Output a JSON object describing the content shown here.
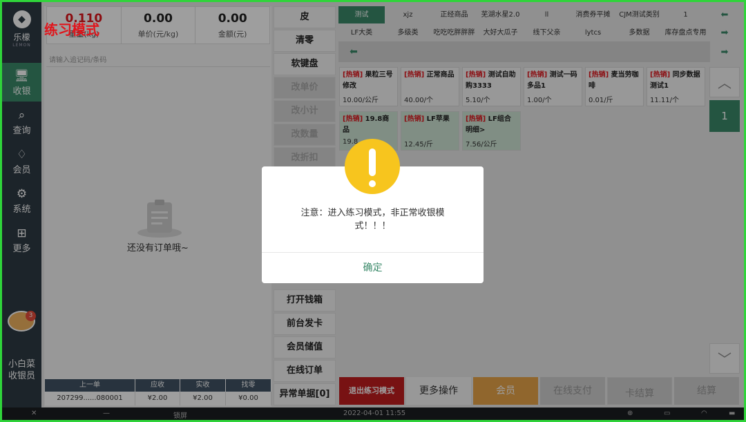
{
  "app": {
    "mode_title": "练习模式",
    "logo_text": "乐檬",
    "logo_sub": "LEMON"
  },
  "nav": [
    {
      "label": "收银",
      "icon": "cashier-icon",
      "glyph": "🖥"
    },
    {
      "label": "查询",
      "icon": "query-icon",
      "glyph": "⌕"
    },
    {
      "label": "会员",
      "icon": "member-icon",
      "glyph": "♢"
    },
    {
      "label": "系统",
      "icon": "system-icon",
      "glyph": "⚙"
    },
    {
      "label": "更多",
      "icon": "more-icon",
      "glyph": "⊞"
    }
  ],
  "avatar_badge": "3",
  "cashier": {
    "line1": "小白菜",
    "line2": "收银员"
  },
  "metrics": {
    "weight_value": "0.110",
    "weight_label": "重量(kg)",
    "unit_price_value": "0.00",
    "unit_price_label": "单价(元/kg)",
    "amount_value": "0.00",
    "amount_label": "金额(元)"
  },
  "scan_placeholder": "请输入追记码/条码",
  "empty_text": "还没有订单哦~",
  "last_order": {
    "headers": [
      "上一单",
      "应收",
      "实收",
      "找零"
    ],
    "values": [
      "207299......080001",
      "¥2.00",
      "¥2.00",
      "¥0.00"
    ]
  },
  "functions": {
    "top": [
      "皮",
      "清零",
      "软键盘"
    ],
    "disabled": [
      "改单价",
      "改小计",
      "改数量",
      "改折扣"
    ],
    "bottom": [
      "打开钱箱",
      "前台发卡",
      "会员储值",
      "在线订单",
      "异常单据[0]"
    ]
  },
  "categories": {
    "row1": [
      "测试",
      "xjz",
      "正经商品",
      "芜湖水星2.0",
      "ll",
      "消费券平摊",
      "CJM测试类别",
      "1"
    ],
    "row2": [
      "LF大类",
      "多级类",
      "吃吃吃胖胖胖",
      "大好大瓜子",
      "线下父亲",
      "lytcs",
      "多数据",
      "库存盘点专用"
    ]
  },
  "products": [
    {
      "tag": "[热销]",
      "name": "果粒三号修改",
      "price": "10.00/公斤"
    },
    {
      "tag": "[热销]",
      "name": "正常商品",
      "price": "40.00/个"
    },
    {
      "tag": "[热销]",
      "name": "测试自助购3333",
      "price": "5.10/个"
    },
    {
      "tag": "[热销]",
      "name": "测试一码多品1",
      "price": "1.00/个"
    },
    {
      "tag": "[热销]",
      "name": "麦当劳咖啡",
      "price": "0.01/斤"
    },
    {
      "tag": "[热销]",
      "name": "同步数据测试1",
      "price": "11.11/个"
    },
    {
      "tag": "[热销]",
      "name": "19.8商品",
      "price": "19.8"
    },
    {
      "tag": "[热销]",
      "name": "LF苹果",
      "price": "12.45/斤"
    },
    {
      "tag": "[热销]",
      "name": "LF组合明细>",
      "price": "7.56/公斤"
    }
  ],
  "page_number": "1",
  "actions": {
    "exit": "退出练习模式",
    "more": "更多操作",
    "member": "会员",
    "online": "在线支付",
    "card": "卡结算",
    "settle": "结算"
  },
  "status": {
    "lock": "锁屏",
    "datetime": "2022-04-01 11:55"
  },
  "dialog": {
    "message": "注意：进入练习模式，非正常收银模式！！！",
    "ok": "确定"
  },
  "colors": {
    "accent": "#3b8a6a",
    "danger": "#c21d1f",
    "hot": "#e0151c",
    "warning": "#f7c51e",
    "member": "#e8a54a"
  }
}
